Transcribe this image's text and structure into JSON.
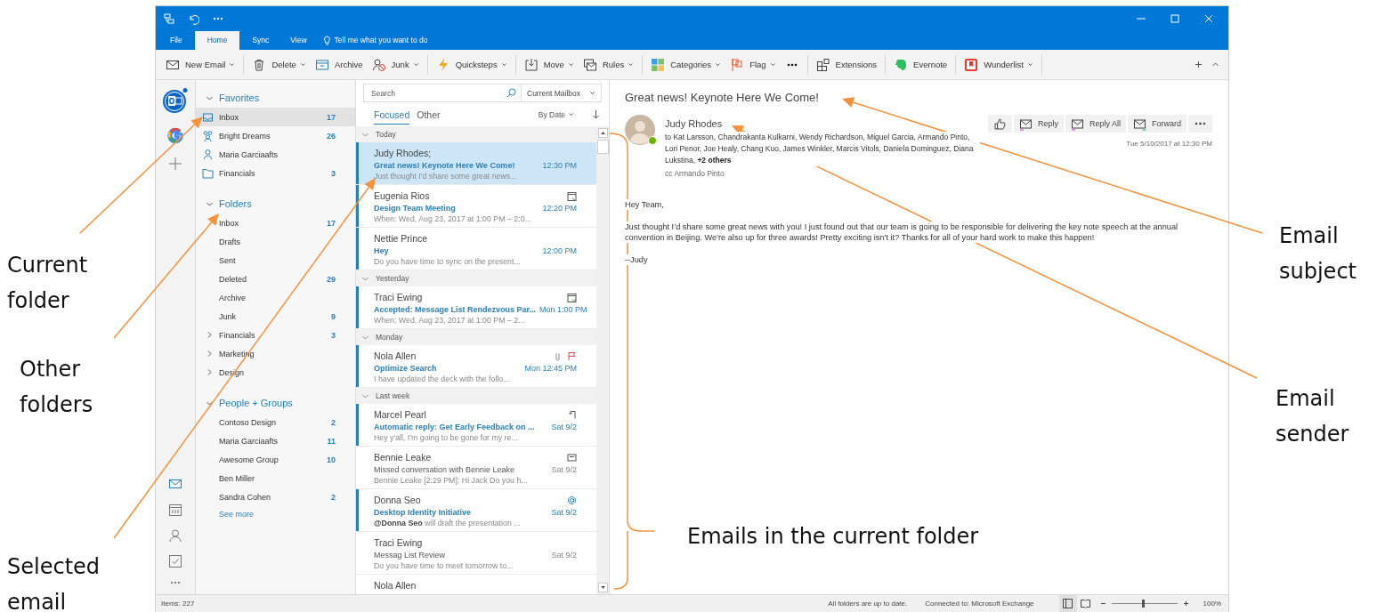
{
  "ribbon": {
    "tabs": [
      {
        "label": "File",
        "selected": false
      },
      {
        "label": "Home",
        "selected": true
      },
      {
        "label": "Sync",
        "selected": false
      },
      {
        "label": "View",
        "selected": false
      }
    ],
    "tell_me": "Tell me what you want to do",
    "commands": [
      {
        "kind": "command",
        "label": "New Email",
        "dropdown": true,
        "separator_after": true
      },
      {
        "kind": "command",
        "label": "Delete",
        "dropdown": true,
        "separator_after": false
      },
      {
        "kind": "command",
        "label": "Archive",
        "dropdown": false,
        "separator_after": false
      },
      {
        "kind": "command",
        "label": "Junk",
        "dropdown": true,
        "separator_after": true
      },
      {
        "kind": "command",
        "label": "Quicksteps",
        "dropdown": true,
        "separator_after": true
      },
      {
        "kind": "command",
        "label": "Move",
        "dropdown": true,
        "separator_after": false
      },
      {
        "kind": "command",
        "label": "Rules",
        "dropdown": true,
        "separator_after": true
      },
      {
        "kind": "command",
        "label": "Categories",
        "dropdown": true,
        "separator_after": false
      },
      {
        "kind": "command",
        "label": "Flag",
        "dropdown": true,
        "separator_after": false
      },
      {
        "kind": "more",
        "separator_after": true
      },
      {
        "kind": "command",
        "label": "Extensions",
        "dropdown": false,
        "separator_after": true
      },
      {
        "kind": "command",
        "label": "Evernote",
        "dropdown": false,
        "separator_after": true
      },
      {
        "kind": "command",
        "label": "Wunderlist",
        "dropdown": true,
        "separator_after": true
      }
    ]
  },
  "folder_pane": {
    "sections": [
      {
        "title": "Favorites",
        "expanded": true,
        "items": [
          {
            "kind": "inbox",
            "label": "Inbox",
            "count": "17",
            "selected": true
          },
          {
            "kind": "group",
            "label": "Bright Dreams",
            "count": "26",
            "selected": false
          },
          {
            "kind": "person",
            "label": "Maria Garciaafts",
            "selected": false
          },
          {
            "kind": "folder",
            "label": "Financials",
            "count": "3",
            "selected": false
          }
        ]
      },
      {
        "title": "Folders",
        "expanded": true,
        "items": [
          {
            "kind": "plain",
            "label": "Inbox",
            "count": "17",
            "selected": false
          },
          {
            "kind": "plain",
            "label": "Drafts",
            "selected": false
          },
          {
            "kind": "plain",
            "label": "Sent",
            "selected": false
          },
          {
            "kind": "plain",
            "label": "Deleted",
            "count": "29",
            "selected": false
          },
          {
            "kind": "plain",
            "label": "Archive",
            "selected": false
          },
          {
            "kind": "plain",
            "label": "Junk",
            "count": "9",
            "selected": false
          },
          {
            "kind": "parent",
            "label": "Financials",
            "count": "3",
            "expanded": false,
            "selected": false
          },
          {
            "kind": "parent",
            "label": "Marketing",
            "expanded": false,
            "selected": false
          },
          {
            "kind": "parent",
            "label": "Design",
            "expanded": false,
            "selected": false
          }
        ]
      },
      {
        "title": "People + Groups",
        "expanded": true,
        "items": [
          {
            "kind": "plain",
            "label": "Contoso Design",
            "count": "2",
            "selected": false
          },
          {
            "kind": "plain",
            "label": "Maria Garciaafts",
            "count": "11",
            "selected": false
          },
          {
            "kind": "plain",
            "label": "Awesome Group",
            "count": "10",
            "selected": false
          },
          {
            "kind": "plain",
            "label": "Ben Miller",
            "selected": false
          },
          {
            "kind": "plain",
            "label": "Sandra Cohen",
            "count": "2",
            "selected": false
          }
        ]
      }
    ],
    "see_more": "See more"
  },
  "message_list": {
    "search_placeholder": "Search",
    "scope": "Current Mailbox",
    "tabs": [
      {
        "label": "Focused",
        "selected": true
      },
      {
        "label": "Other",
        "selected": false
      }
    ],
    "sort": "By Date",
    "groups": [
      {
        "label": "Today",
        "messages": [
          {
            "kind": "mail",
            "sender": "Judy Rhodes;",
            "subject": "Great news! Keynote Here We Come!",
            "preview": "Just thought I'd share some great news...",
            "time": "12:30 PM",
            "unread": true,
            "selected": true,
            "attachment": false,
            "flagged": false
          },
          {
            "kind": "meeting_request",
            "sender": "Eugenia Rios",
            "subject": "Design Team Meeting",
            "preview": "When: Wed, Aug 23, 2017 at 1:00 PM – 2:0...",
            "time": "12:20 PM",
            "unread": true,
            "selected": false,
            "attachment": false,
            "flagged": false
          },
          {
            "kind": "mail",
            "sender": "Nettie Prince",
            "subject": "Hey",
            "preview": "Do you have time to sync on the present...",
            "time": "12:00 PM",
            "unread": true,
            "selected": false,
            "attachment": false,
            "flagged": false
          }
        ]
      },
      {
        "label": "Yesterday",
        "messages": [
          {
            "kind": "meeting_response",
            "sender": "Traci Ewing",
            "subject": "Accepted: Message List Rendezvous Par...",
            "preview": "When: Wed, Aug 23, 2017 at 1:00 PM – 2...",
            "time": "Mon 1:00 PM",
            "unread": true,
            "selected": false,
            "attachment": false,
            "flagged": false
          }
        ]
      },
      {
        "label": "Monday",
        "messages": [
          {
            "kind": "mail",
            "sender": "Nola Allen",
            "subject": "Optimize Search",
            "preview": "I have updated the deck with the follo...",
            "time": "Mon 12:45 PM",
            "unread": true,
            "selected": false,
            "attachment": true,
            "flagged": true
          }
        ]
      },
      {
        "label": "Last week",
        "messages": [
          {
            "kind": "auto_reply",
            "sender": "Marcel Pearl",
            "subject": "Automatic reply: Get Early Feedback on ...",
            "preview": "Hey y'all, I'm going to be gone for my re...",
            "time": "Sat 9/2",
            "unread": true,
            "selected": false,
            "attachment": false,
            "flagged": false
          },
          {
            "kind": "conversation",
            "sender": "Bennie Leake",
            "subject": "Missed conversation with Bennie Leake",
            "preview": "Bennie Leake [2:29 PM]: Hi Jack Do you h...",
            "time": "Sat 9/2",
            "unread": false,
            "selected": false,
            "attachment": false,
            "flagged": false
          },
          {
            "kind": "mention",
            "sender": "Donna Seo",
            "subject": "Desktop Identity Initiative",
            "preview": "**@Donna Seo** will draft the presentation ...",
            "time": "Sat 9/2",
            "unread": true,
            "selected": false,
            "attachment": false,
            "flagged": false
          },
          {
            "kind": "mail",
            "sender": "Traci Ewing",
            "subject": "Messag List Review",
            "preview": "Do you have time to meet tomorrow to...",
            "time": "Sat 9/2",
            "unread": false,
            "selected": false,
            "attachment": false,
            "flagged": false
          },
          {
            "kind": "mail",
            "sender": "Nola Allen",
            "unread": false,
            "selected": false,
            "attachment": false,
            "flagged": false
          }
        ]
      }
    ]
  },
  "reading_pane": {
    "subject": "Great news! Keynote Here We Come!",
    "sender": "Judy Rhodes",
    "to": "to Kat Larsson, Chandrakanta Kulkarni, Wendy Richardson, Miguel Garcia, Armando Pinto, Lori Penor, Joe Healy, Chang Kuo, James Winkler, Marcis Vitols, Daniela Dominguez, Diana Lukstina, **+2 others**",
    "cc": "cc Armando Pinto",
    "date": "Tue 5/10/2017 at 12:30 PM",
    "actions": [
      {
        "kind": "like"
      },
      {
        "kind": "reply",
        "label": "Reply"
      },
      {
        "kind": "reply_all",
        "label": "Reply All"
      },
      {
        "kind": "forward",
        "label": "Forward"
      },
      {
        "kind": "more"
      }
    ],
    "body": [
      "Hey Team,",
      "Just thought I’d share some great news with you! I just found out that our team is going to be responsible for delivering the key note speech at the annual convention in Beijing. We’re also up for three awards! Pretty exciting isn’t it? Thanks for all of your hard work to make this happen!",
      "--Judy"
    ]
  },
  "status_bar": {
    "items": "Items: 227",
    "sync": "All folders are up to date.",
    "connection": "Connected to: Microsoft Exchange",
    "zoom": {
      "level": 0.48,
      "reading": "100%"
    }
  },
  "annotations": [
    {
      "text": "Current folder"
    },
    {
      "text": "Other folders"
    },
    {
      "text": "Selected email"
    },
    {
      "text": "Email subject"
    },
    {
      "text": "Email sender"
    },
    {
      "text": "Emails in the current folder"
    }
  ]
}
